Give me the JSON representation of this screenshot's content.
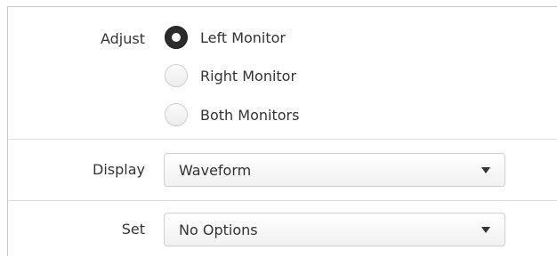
{
  "adjust": {
    "label": "Adjust",
    "options": [
      {
        "label": "Left Monitor",
        "checked": true
      },
      {
        "label": "Right Monitor",
        "checked": false
      },
      {
        "label": "Both Monitors",
        "checked": false
      }
    ]
  },
  "display": {
    "label": "Display",
    "value": "Waveform"
  },
  "set": {
    "label": "Set",
    "value": "No Options"
  },
  "icons": {
    "dropdown": "chevron-down-icon",
    "radio_checked": "radio-checked-icon",
    "radio_unchecked": "radio-unchecked-icon"
  }
}
